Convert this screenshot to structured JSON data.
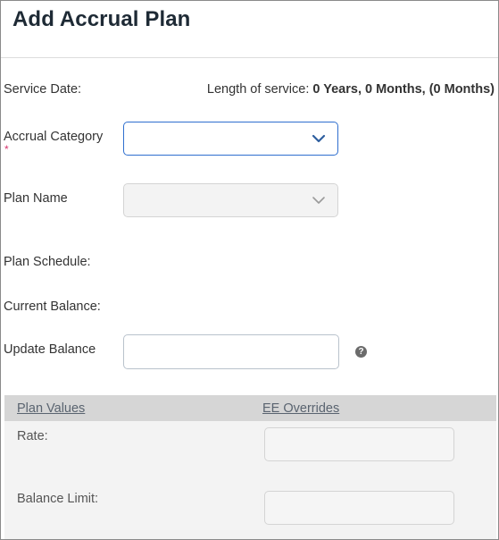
{
  "title": "Add Accrual Plan",
  "service_date_label": "Service Date:",
  "length_of_service": {
    "label": "Length of service:",
    "value": "0 Years, 0 Months, (0 Months)"
  },
  "accrual_category": {
    "label": "Accrual Category",
    "required_mark": "*",
    "value": ""
  },
  "plan_name": {
    "label": "Plan Name",
    "value": ""
  },
  "plan_schedule_label": "Plan Schedule:",
  "current_balance_label": "Current Balance:",
  "update_balance": {
    "label": "Update Balance",
    "value": "",
    "help_glyph": "?"
  },
  "overrides": {
    "col_plan_values": "Plan Values",
    "col_ee_overrides": "EE Overrides",
    "rate_label": "Rate:",
    "balance_limit_label": "Balance Limit:",
    "rate_value": "",
    "balance_limit_value": ""
  },
  "colors": {
    "accent": "#2f6fcf",
    "required": "#d6336c",
    "panel_header": "#d6d6d6",
    "panel_bg": "#f3f3f3"
  },
  "icons": {
    "dropdown": "chevron-down-icon",
    "help": "help-icon"
  }
}
